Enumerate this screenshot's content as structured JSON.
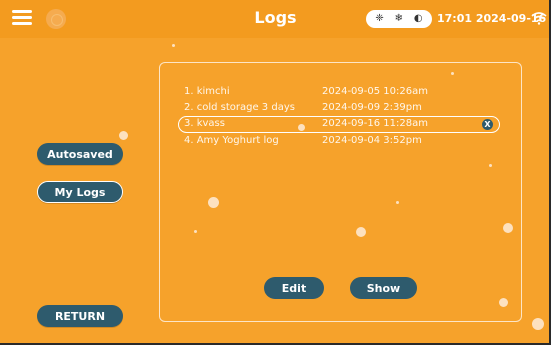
{
  "header": {
    "title": "Logs",
    "datetime": "17:01 2024-09-16",
    "status_icons": [
      "❈",
      "❄",
      "◐"
    ]
  },
  "sidebar": {
    "autosaved_label": "Autosaved",
    "mylogs_label": "My Logs",
    "return_label": "RETURN"
  },
  "logs": [
    {
      "name": "1. kimchi",
      "date": "2024-09-05 10:26am"
    },
    {
      "name": "2. cold storage 3 days",
      "date": "2024-09-09 2:39pm"
    },
    {
      "name": "3. kvass",
      "date": "2024-09-16 11:28am",
      "selected": true
    },
    {
      "name": "4. Amy Yoghurt log",
      "date": "2024-09-04 3:52pm"
    }
  ],
  "selected_close_label": "X",
  "actions": {
    "edit_label": "Edit",
    "show_label": "Show"
  },
  "colors": {
    "background": "#f6a22b",
    "topbar": "#f39b1f",
    "button": "#2e5b6d",
    "text": "#ffffff"
  }
}
